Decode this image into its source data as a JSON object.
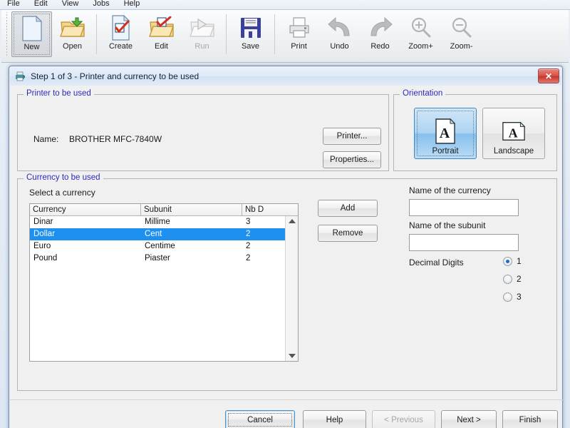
{
  "app": {
    "menu": [
      "File",
      "Edit",
      "View",
      "Jobs",
      "Help"
    ],
    "toolbar": [
      {
        "label": "New",
        "icon": "new-document-icon",
        "state": "pressed"
      },
      {
        "label": "Open",
        "icon": "open-folder-icon",
        "state": "normal"
      },
      {
        "label": "Create",
        "icon": "create-check-document-icon",
        "state": "normal"
      },
      {
        "label": "Edit",
        "icon": "edit-check-folder-icon",
        "state": "normal"
      },
      {
        "label": "Run",
        "icon": "run-play-folder-icon",
        "state": "disabled"
      },
      {
        "label": "Save",
        "icon": "floppy-disk-icon",
        "state": "normal"
      },
      {
        "label": "Print",
        "icon": "printer-icon",
        "state": "normal"
      },
      {
        "label": "Undo",
        "icon": "undo-arrow-icon",
        "state": "normal"
      },
      {
        "label": "Redo",
        "icon": "redo-arrow-icon",
        "state": "normal"
      },
      {
        "label": "Zoom+",
        "icon": "zoom-in-icon",
        "state": "normal"
      },
      {
        "label": "Zoom-",
        "icon": "zoom-out-icon",
        "state": "normal"
      }
    ]
  },
  "dialog": {
    "title": "Step 1 of 3 - Printer and currency to be used",
    "title_icon": "printer-wizard-icon",
    "close_label": "✕",
    "printer_group": {
      "title": "Printer to be used",
      "name_label": "Name:",
      "name_value": "BROTHER MFC-7840W",
      "printer_button": "Printer...",
      "properties_button": "Properties..."
    },
    "orientation_group": {
      "title": "Orientation",
      "options": [
        {
          "label": "Portrait",
          "selected": true
        },
        {
          "label": "Landscape",
          "selected": false
        }
      ]
    },
    "currency_group": {
      "title": "Currency to be used",
      "select_label": "Select a currency",
      "columns": [
        "Currency",
        "Subunit",
        "Nb D"
      ],
      "rows": [
        {
          "currency": "Dinar",
          "subunit": "Millime",
          "nbd": "3",
          "selected": false
        },
        {
          "currency": "Dollar",
          "subunit": "Cent",
          "nbd": "2",
          "selected": true
        },
        {
          "currency": "Euro",
          "subunit": "Centime",
          "nbd": "2",
          "selected": false
        },
        {
          "currency": "Pound",
          "subunit": "Piaster",
          "nbd": "2",
          "selected": false
        }
      ],
      "add_button": "Add",
      "remove_button": "Remove",
      "currency_name_label": "Name of the currency",
      "currency_name_value": "",
      "subunit_name_label": "Name of the subunit",
      "subunit_name_value": "",
      "decimal_digits_label": "Decimal Digits",
      "decimal_options": [
        {
          "label": "1",
          "selected": true
        },
        {
          "label": "2",
          "selected": false
        },
        {
          "label": "3",
          "selected": false
        }
      ]
    },
    "footer": {
      "cancel": "Cancel",
      "help": "Help",
      "previous": "< Previous",
      "next": "Next >",
      "finish": "Finish"
    }
  },
  "colors": {
    "selection_blue": "#1e90f0",
    "group_title_blue": "#2b2bbd",
    "close_red": "#c7372c"
  }
}
